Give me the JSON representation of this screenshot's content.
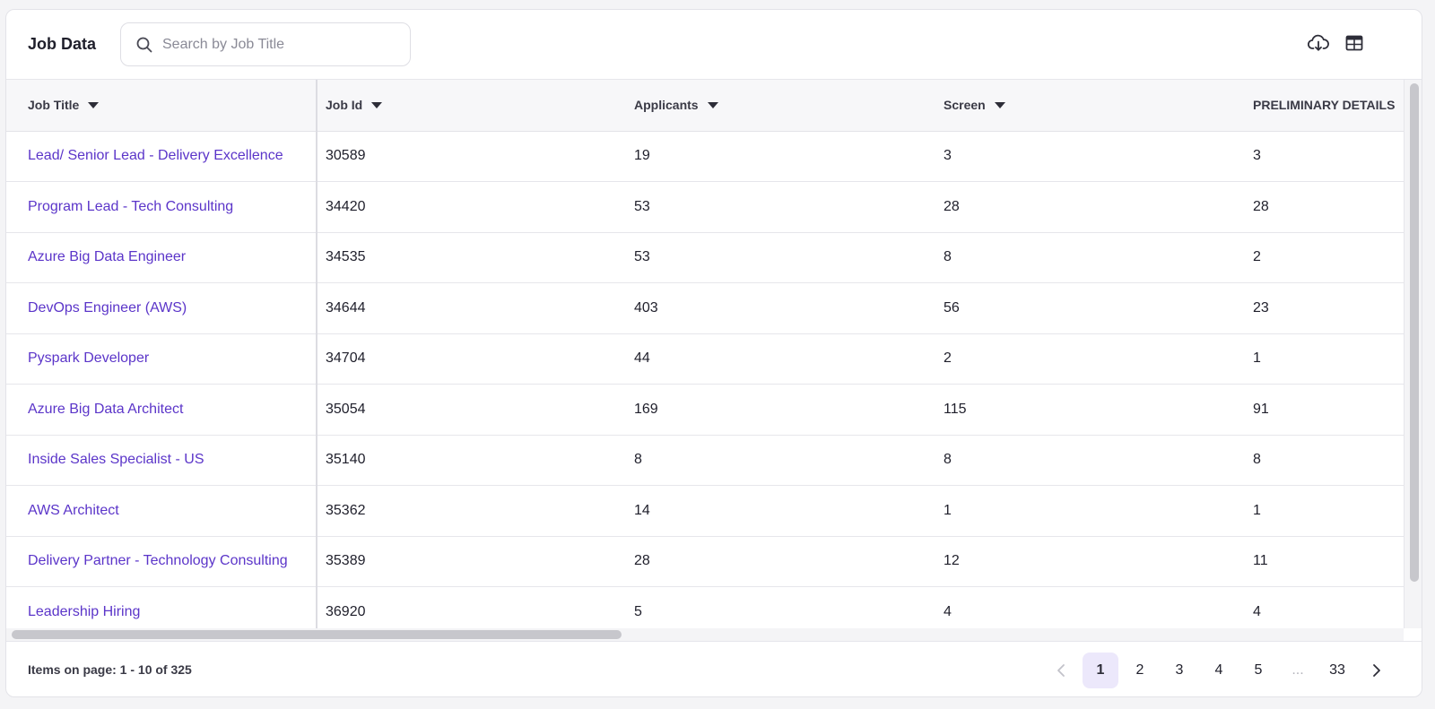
{
  "header": {
    "title": "Job Data",
    "search_placeholder": "Search by Job Title",
    "search_value": "",
    "download_icon": "cloud-download-icon",
    "columns_icon": "table-columns-icon"
  },
  "table": {
    "columns": [
      "Job Title",
      "Job Id",
      "Applicants",
      "Screen",
      "PRELIMINARY DETAILS"
    ],
    "rows": [
      {
        "title": "Lead/ Senior Lead - Delivery Excellence",
        "job_id": "30589",
        "applicants": "19",
        "screen": "3",
        "preliminary": "3"
      },
      {
        "title": "Program Lead - Tech Consulting",
        "job_id": "34420",
        "applicants": "53",
        "screen": "28",
        "preliminary": "28"
      },
      {
        "title": "Azure Big Data Engineer",
        "job_id": "34535",
        "applicants": "53",
        "screen": "8",
        "preliminary": "2"
      },
      {
        "title": "DevOps Engineer (AWS)",
        "job_id": "34644",
        "applicants": "403",
        "screen": "56",
        "preliminary": "23"
      },
      {
        "title": "Pyspark Developer",
        "job_id": "34704",
        "applicants": "44",
        "screen": "2",
        "preliminary": "1"
      },
      {
        "title": "Azure Big Data Architect",
        "job_id": "35054",
        "applicants": "169",
        "screen": "115",
        "preliminary": "91"
      },
      {
        "title": "Inside Sales Specialist - US",
        "job_id": "35140",
        "applicants": "8",
        "screen": "8",
        "preliminary": "8"
      },
      {
        "title": "AWS Architect",
        "job_id": "35362",
        "applicants": "14",
        "screen": "1",
        "preliminary": "1"
      },
      {
        "title": "Delivery Partner - Technology Consulting",
        "job_id": "35389",
        "applicants": "28",
        "screen": "12",
        "preliminary": "11"
      },
      {
        "title": "Leadership Hiring",
        "job_id": "36920",
        "applicants": "5",
        "screen": "4",
        "preliminary": "4"
      }
    ]
  },
  "footer": {
    "items_info": "Items on page: 1 - 10 of 325",
    "pages": [
      "1",
      "2",
      "3",
      "4",
      "5",
      "...",
      "33"
    ],
    "active_page": "1"
  },
  "colors": {
    "link": "#5b35c9",
    "active_page_bg": "#ece8fb"
  }
}
